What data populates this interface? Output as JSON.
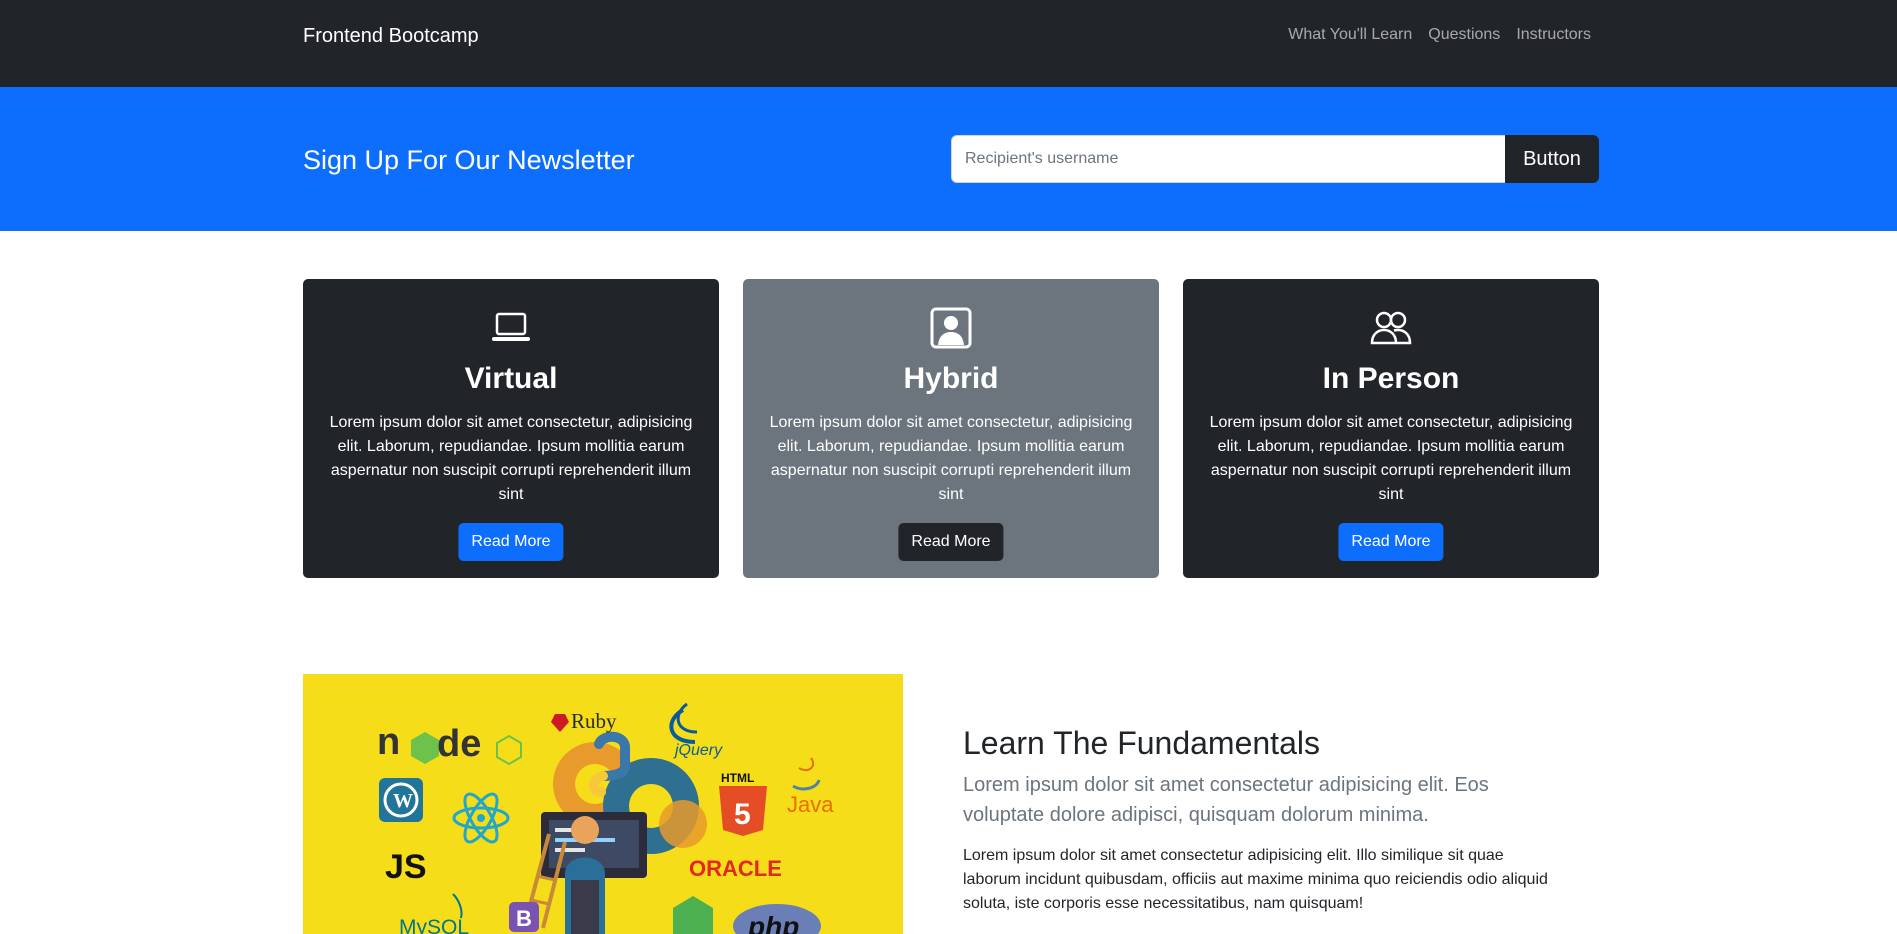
{
  "navbar": {
    "brand": "Frontend Bootcamp",
    "links": [
      "What You'll Learn",
      "Questions",
      "Instructors"
    ]
  },
  "newsletter": {
    "title": "Sign Up For Our Newsletter",
    "input_placeholder": "Recipient's username",
    "button_label": "Button"
  },
  "cards": [
    {
      "icon": "laptop-icon",
      "title": "Virtual",
      "text": "Lorem ipsum dolor sit amet consectetur, adipisicing elit. Laborum, repudiandae. Ipsum mollitia earum aspernatur non suscipit corrupti reprehenderit illum sint",
      "button_label": "Read More"
    },
    {
      "icon": "person-square-icon",
      "title": "Hybrid",
      "text": "Lorem ipsum dolor sit amet consectetur, adipisicing elit. Laborum, repudiandae. Ipsum mollitia earum aspernatur non suscipit corrupti reprehenderit illum sint",
      "button_label": "Read More"
    },
    {
      "icon": "people-icon",
      "title": "In Person",
      "text": "Lorem ipsum dolor sit amet consectetur, adipisicing elit. Laborum, repudiandae. Ipsum mollitia earum aspernatur non suscipit corrupti reprehenderit illum sint",
      "button_label": "Read More"
    }
  ],
  "fundamentals": {
    "title": "Learn The Fundamentals",
    "lead": "Lorem ipsum dolor sit amet consectetur adipisicing elit. Eos voluptate dolore adipisci, quisquam dolorum minima.",
    "text": "Lorem ipsum dolor sit amet consectetur adipisicing elit. Illo similique sit quae laborum incidunt quibusdam, officiis aut maxime minima quo reiciendis odio aliquid soluta, iste corporis esse necessitatibus, nam quisquam!",
    "illustration": {
      "logos": [
        "node",
        "Ruby",
        "jQuery",
        "HTML",
        "Java",
        "JS",
        "ORACLE",
        "MySQL",
        "B",
        "php"
      ]
    }
  },
  "colors": {
    "dark": "#212529",
    "primary": "#0d6efd",
    "secondary": "#6c757d",
    "illustration_bg": "#f5de19"
  }
}
